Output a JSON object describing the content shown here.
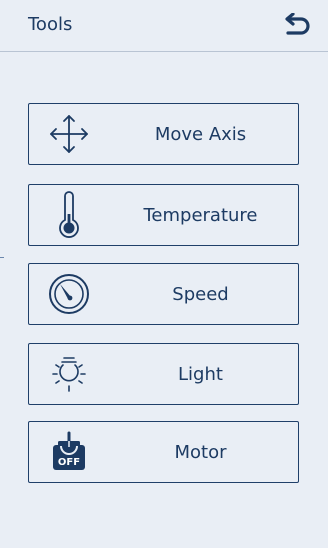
{
  "header": {
    "title": "Tools"
  },
  "menu": {
    "items": [
      {
        "label": "Move Axis",
        "icon": "move-axis-icon"
      },
      {
        "label": "Temperature",
        "icon": "thermometer-icon"
      },
      {
        "label": "Speed",
        "icon": "speedometer-icon"
      },
      {
        "label": "Light",
        "icon": "light-bulb-icon"
      },
      {
        "label": "Motor",
        "icon": "motor-off-icon",
        "icon_text": "OFF"
      }
    ]
  },
  "colors": {
    "background": "#e9eef5",
    "accent": "#1d3b63",
    "border": "#1f3f69"
  }
}
